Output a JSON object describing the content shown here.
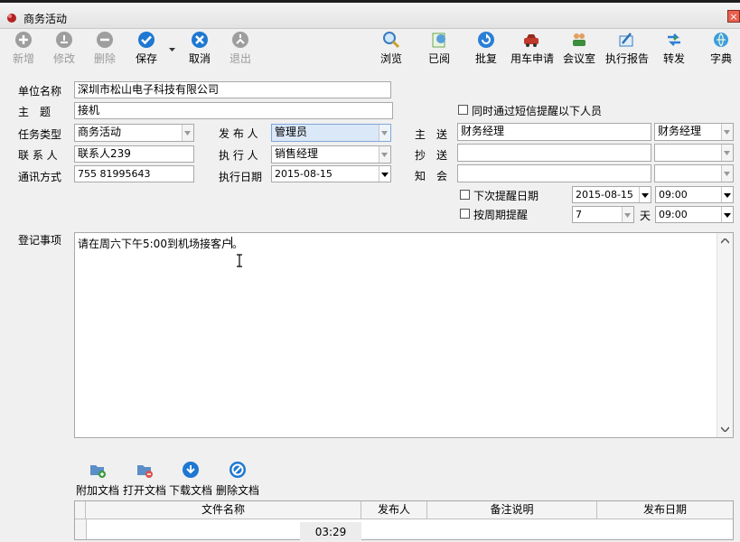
{
  "window": {
    "title": "商务活动",
    "close": "×"
  },
  "toolbar": {
    "add": "新增",
    "edit": "修改",
    "delete": "删除",
    "save": "保存",
    "cancel": "取消",
    "exit": "退出",
    "browse": "浏览",
    "read": "已阅",
    "reply": "批复",
    "car_request": "用车申请",
    "meeting_room": "会议室",
    "exec_report": "执行报告",
    "forward": "转发",
    "dictionary": "字典"
  },
  "form": {
    "company_label": "单位名称",
    "company_value": "深圳市松山电子科技有限公司",
    "subject_label": "主　题",
    "subject_value": "接机",
    "task_type_label": "任务类型",
    "task_type_value": "商务活动",
    "contact_label": "联 系 人",
    "contact_value": "联系人239",
    "phone_label": "通讯方式",
    "phone_value": "755 81995643",
    "publisher_label": "发 布 人",
    "publisher_value": "管理员",
    "executor_label": "执 行 人",
    "executor_value": "销售经理",
    "exec_date_label": "执行日期",
    "exec_date_value": "2015-08-15",
    "sms_label": "同时通过短信提醒以下人员",
    "main_send_label": "主　送",
    "main_send_value": "财务经理",
    "main_send_select": "财务经理",
    "cc_label": "抄　送",
    "cc_value": "",
    "cc_select": "",
    "notify_label": "知　会",
    "notify_value": "",
    "notify_select": "",
    "next_remind_label": "下次提醒日期",
    "next_remind_date": "2015-08-15",
    "next_remind_time": "09:00",
    "period_remind_label": "按周期提醒",
    "period_value": "7",
    "period_unit": "天",
    "period_time": "09:00",
    "notes_label": "登记事项",
    "notes_value": "请在周六下午5:00到机场接客户。"
  },
  "docs": {
    "attach": "附加文档",
    "open": "打开文档",
    "download": "下载文档",
    "delete": "删除文档",
    "columns": [
      "文件名称",
      "发布人",
      "备注说明",
      "发布日期"
    ]
  },
  "clock": "03:29",
  "colors": {
    "accent": "#1e78d2",
    "selected_field": "#dbe8f8"
  }
}
